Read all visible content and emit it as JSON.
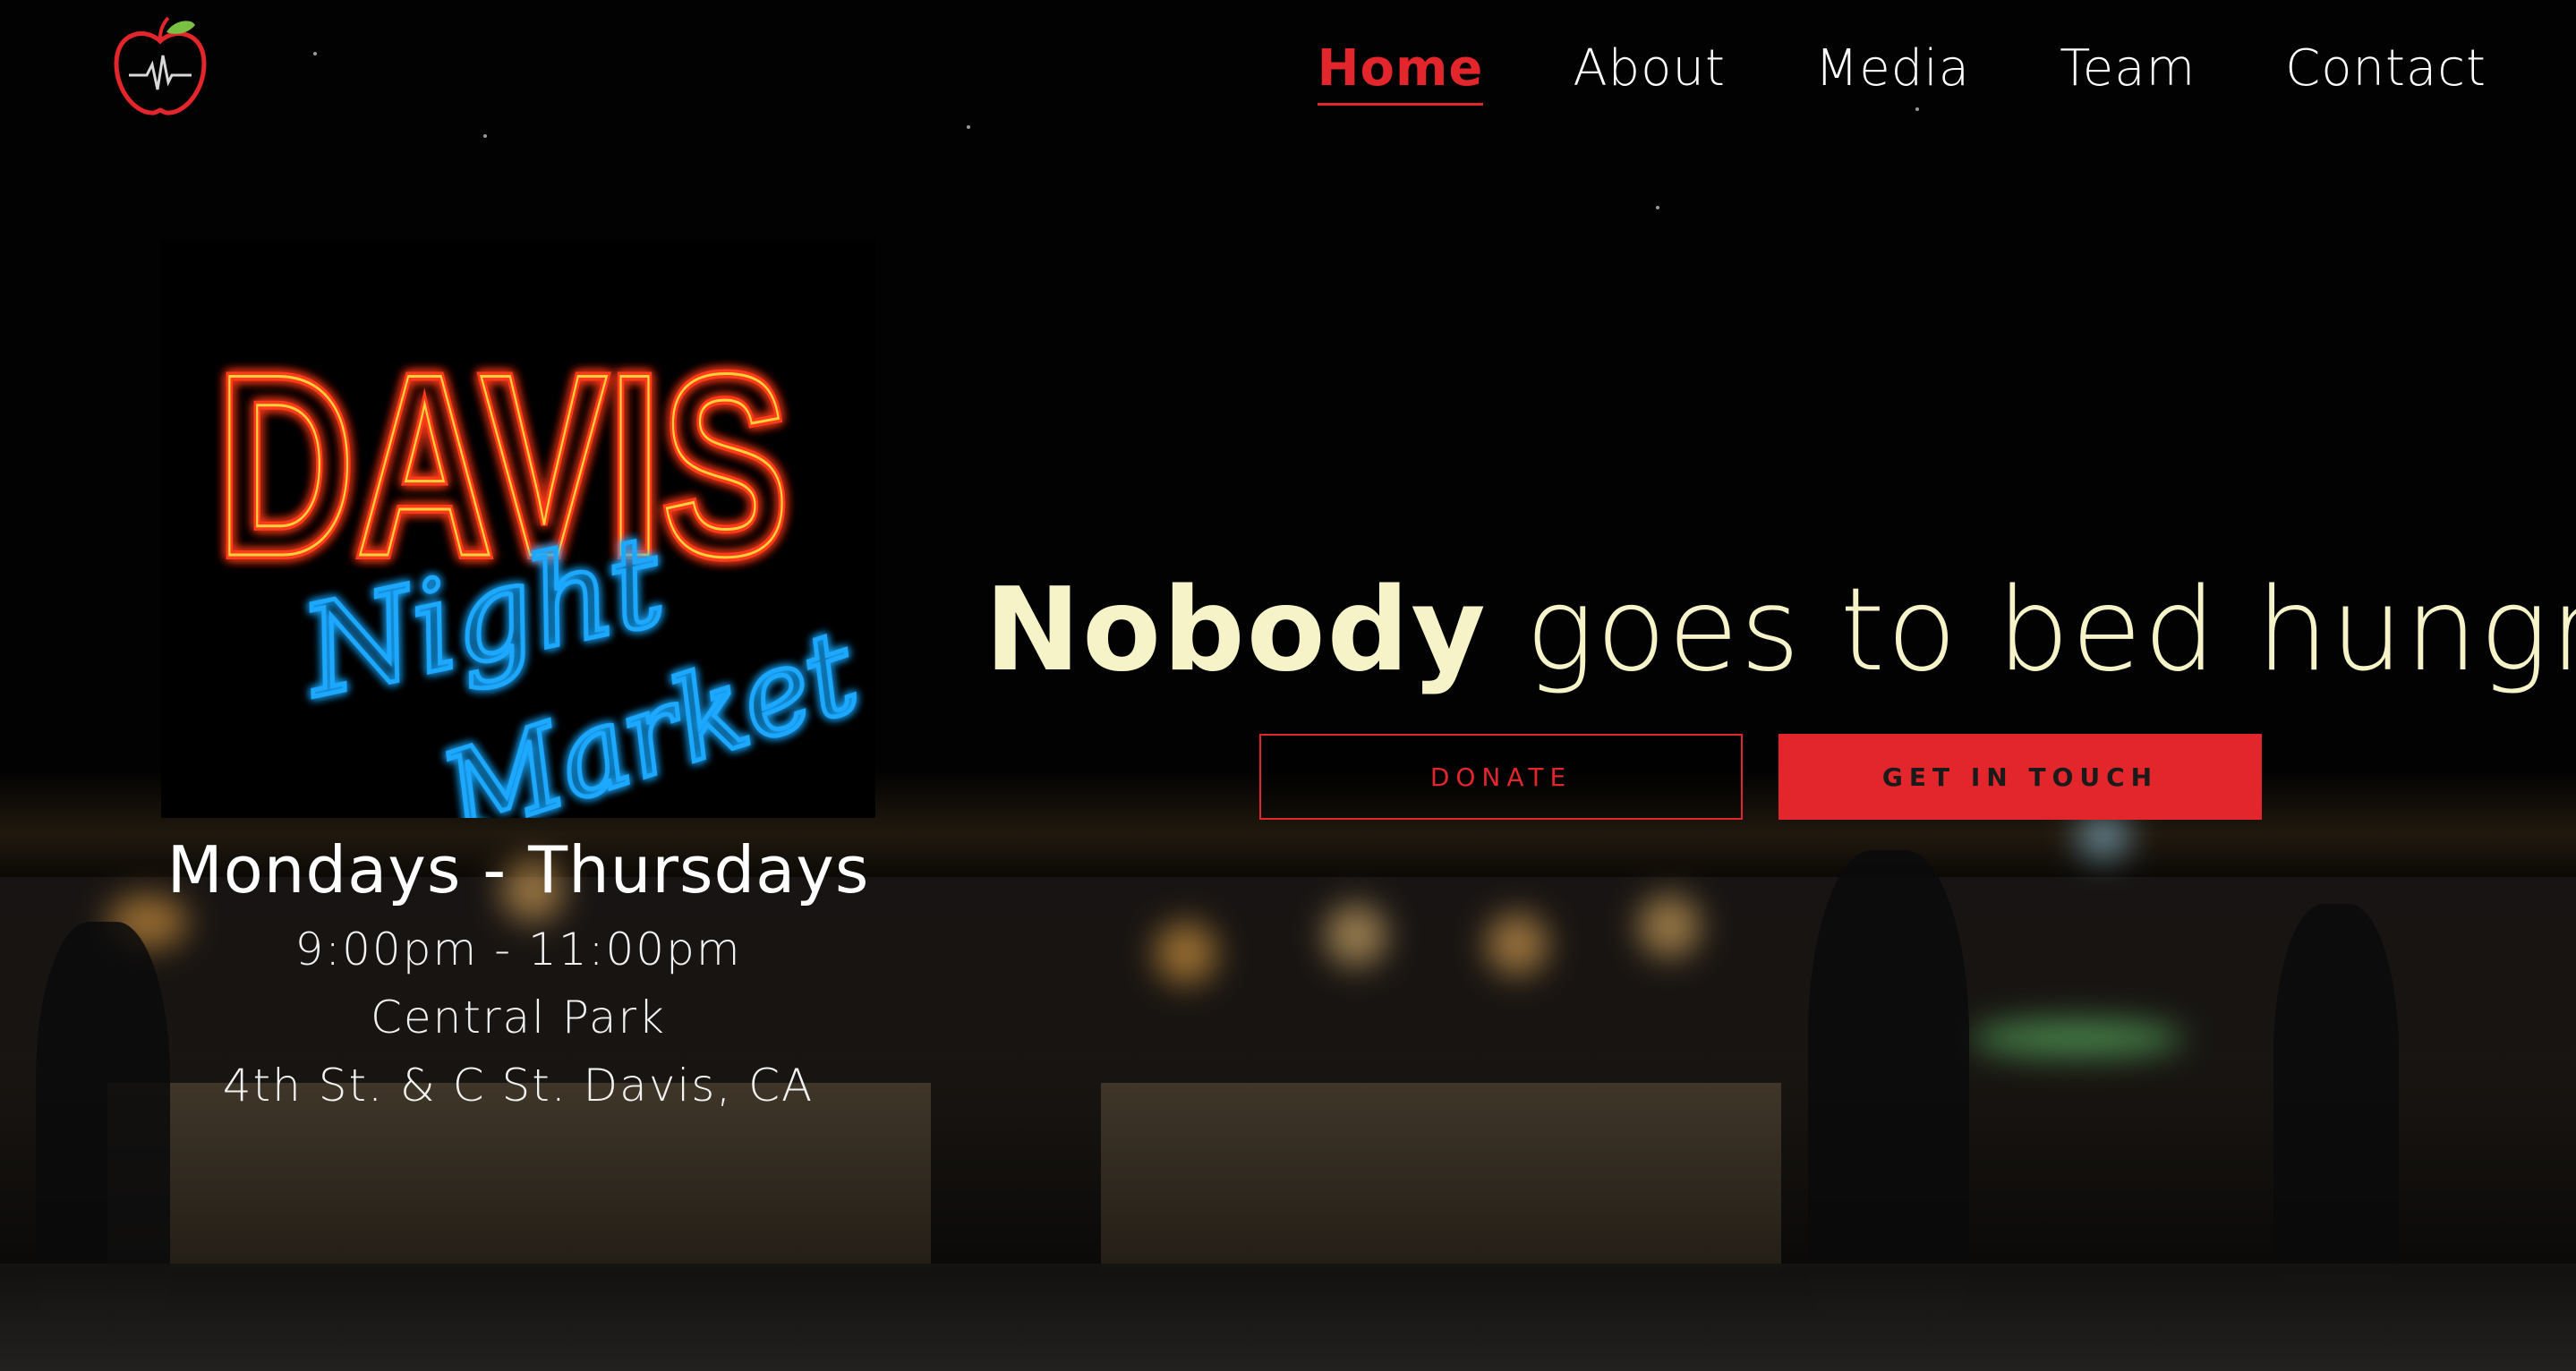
{
  "nav": {
    "logo_icon": "apple-heartbeat-logo",
    "items": [
      {
        "label": "Home",
        "active": true
      },
      {
        "label": "About",
        "active": false
      },
      {
        "label": "Media",
        "active": false
      },
      {
        "label": "Team",
        "active": false
      },
      {
        "label": "Contact",
        "active": false
      }
    ]
  },
  "sign": {
    "line1": "DAVIS",
    "line2": "Night",
    "line3": "Market"
  },
  "schedule": {
    "days": "Mondays - Thursdays",
    "time": "9:00pm - 11:00pm",
    "place": "Central Park",
    "address": "4th St. & C St. Davis, CA"
  },
  "hero": {
    "headline_bold": "Nobody",
    "headline_light": "goes to bed hungry."
  },
  "buttons": {
    "donate": "DONATE",
    "contact": "GET IN TOUCH"
  },
  "colors": {
    "accent": "#e2262c",
    "headline": "#f6f3c8",
    "neon_red": "#ff3b1f",
    "neon_yellow": "#ffd23a",
    "neon_blue": "#1ea8ff"
  }
}
